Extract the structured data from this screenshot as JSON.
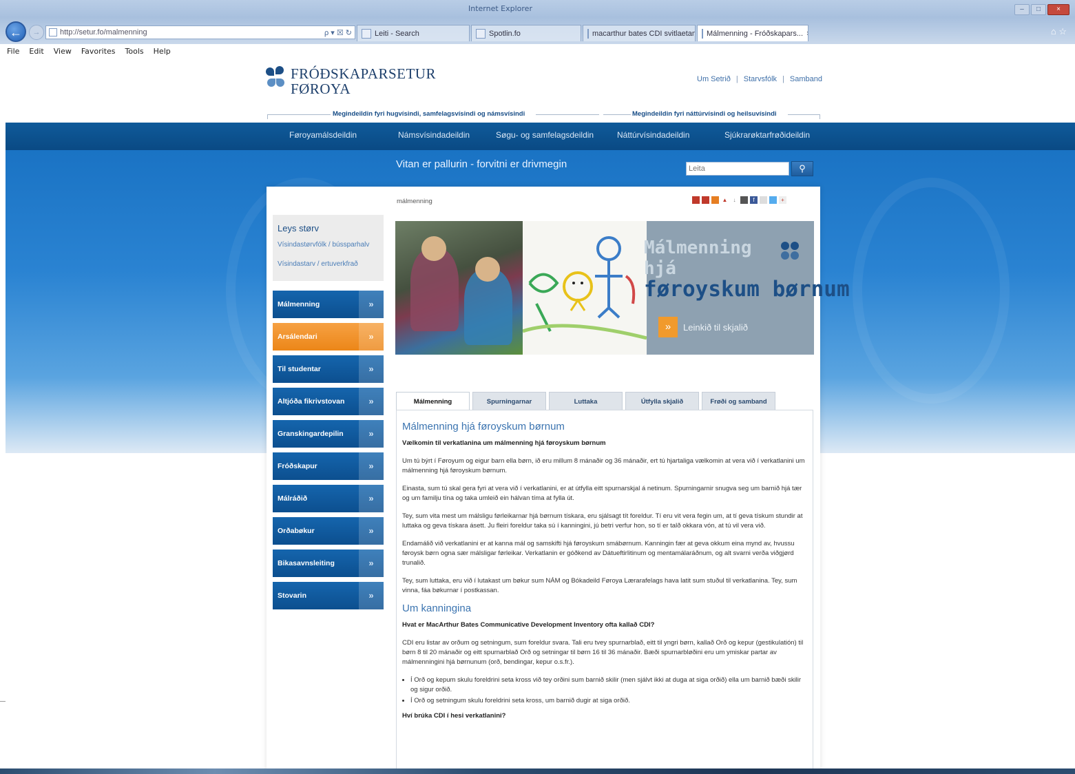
{
  "browser": {
    "window_title": "Internet Explorer",
    "address": "http://setur.fo/malmenning",
    "address_icons": "ρ ▾ ☒ ↻",
    "tabs": [
      {
        "label": "Leiti - Search",
        "active": false
      },
      {
        "label": "Spotlin.fo",
        "active": false
      },
      {
        "label": "macarthur bates CDI svitlaetan...",
        "active": false
      },
      {
        "label": "Málmenning - Fróðskapars...",
        "active": true
      }
    ],
    "tab_close": "×",
    "menu": [
      "File",
      "Edit",
      "View",
      "Favorites",
      "Tools",
      "Help"
    ],
    "chrome_icons": "⌂ ☆"
  },
  "header": {
    "logo_line1": "FRÓÐSKAPARSETUR",
    "logo_line2": "FØROYA",
    "top_links": [
      "Um Setrið",
      "Starvsfólk",
      "Samband"
    ],
    "link_separator": "|",
    "faculty_left": "Megindeildin fyri hugvísindi, samfelagsvísindi og námsvísindi",
    "faculty_right": "Megindeildin fyri náttúrvísindi og heilsuvísindi"
  },
  "nav": [
    "Føroyamálsdeildin",
    "Námsvísindadeildin",
    "Søgu- og samfelagsdeildin",
    "Náttúrvísindadeildin",
    "Sjúkrarøktarfrøðideildin"
  ],
  "slogan": "Vitan er pallurin - forvitni er drivmegin",
  "search": {
    "placeholder": "Leita",
    "button_icon": "🔍"
  },
  "breadcrumb": "málmenning",
  "sidebar": {
    "jobs_title": "Leys størv",
    "jobs_links": [
      "Vísindastørvfólk / bússparhalv",
      "Vísindastarv / ertuverkfrað"
    ],
    "chevron": "»",
    "buttons": [
      {
        "label": "Málmenning",
        "highlight": false
      },
      {
        "label": "Arsálendari",
        "highlight": true
      },
      {
        "label": "Til studentar",
        "highlight": false
      },
      {
        "label": "Altjóða fikrivstovan",
        "highlight": false
      },
      {
        "label": "Granskingardepilin",
        "highlight": false
      },
      {
        "label": "Fróðskapur",
        "highlight": false
      },
      {
        "label": "Málráðið",
        "highlight": false
      },
      {
        "label": "Orðabøkur",
        "highlight": false
      },
      {
        "label": "Bikasavnsleiting",
        "highlight": false
      },
      {
        "label": "Stovarin",
        "highlight": false
      }
    ]
  },
  "banner": {
    "title_line1": "Málmenning",
    "title_line2": "hjá",
    "title_line3": "føroyskum børnum",
    "button_icon": "»",
    "button_label": "Leinkið til skjalið"
  },
  "content_tabs": [
    {
      "label": "Málmenning",
      "active": true
    },
    {
      "label": "Spurningarnar",
      "active": false
    },
    {
      "label": "Luttaka",
      "active": false
    },
    {
      "label": "Útfylla skjalið",
      "active": false
    },
    {
      "label": "Frøði og samband",
      "active": false
    }
  ],
  "article": {
    "heading": "Málmenning hjá føroyskum børnum",
    "lead": "Vælkomin til verkatlanina um málmenning hjá føroyskum børnum",
    "paragraphs": [
      "Um tú býrt í Føroyum og eigur barn ella børn, ið eru millum 8 mánaðir og 36 mánaðir, ert tú hjartaliga vælkomin at vera við í verkatlanini um málmenning hjá føroyskum børnum.",
      "Einasta, sum tú skal gera fyri at vera við í verkatlanini, er at útfylla eitt spurnarskjal á netinum. Spurningarnir snugva seg um barnið hjá tær og um familju tína og taka umleið ein hálvan tíma at fylla út.",
      "Tey, sum vita mest um málsligu førleikarnar hjá børnum tískara, eru sjálsagt tít foreldur. Tí eru vit vera fegin um, at tí geva tískum stundir at luttaka og geva tískara ásett. Ju fleiri foreldur taka sú í kanningini, jú betri verfur hon, so tí er talð okkara vón, at tú vil vera við.",
      "Endamálið við verkatlanini er at kanna mál og samskifti hjá føroyskum smábørnum. Kanningin fær at geva okkum eina mynd av, hvussu føroysk børn ogna sær málsligar førleikar. Verkatlanin er góðkend av Dátueftirlitinum og mentamálaráðnum, og alt svarni verða viðgjørd trunalið.",
      "Tey, sum luttaka, eru við í lutakast um bøkur sum NÁM og Bókadeild Føroya Lærarafelags hava latit sum stuðul til verkatlanina. Tey, sum vinna, fáa bøkurnar í postkassan."
    ],
    "subheading": "Um kanningina",
    "subheading_lead": "Hvat er MacArthur Bates Communicative Development Inventory ofta kallað CDI?",
    "cdi_paragraph": "CDI eru listar av orðum og setningum, sum foreldur svara. Tali eru tvey spurnarblað, eitt til yngri børn, kallað Orð og kepur (gestikulatión) til børn 8 til 20 mánaðir og eitt spurnarblað Orð og setningar til børn 16 til 36 mánaðir. Bæði spurnarbløðini eru um ymiskar partar av málmenningini hjá børnunum (orð, bendingar, kepur o.s.fr.).",
    "bullets": [
      "Í Orð og kepum skulu foreldrini seta kross við tey orðini sum barnið skilir (men sjálvt ikki at duga at siga orðið) ella um barnið bæði skilir og sigur orðið.",
      "Í Orð og setningum skulu foreldrini seta kross, um barnið dugir at siga orðið."
    ],
    "last_lead": "Hví brúka CDI í hesi verkatlanini?"
  },
  "colors": {
    "nav_blue": "#0c4f8f",
    "band_blue": "#1a73c4",
    "accent_orange": "#f19a2c",
    "heading_blue": "#3b74b0"
  }
}
